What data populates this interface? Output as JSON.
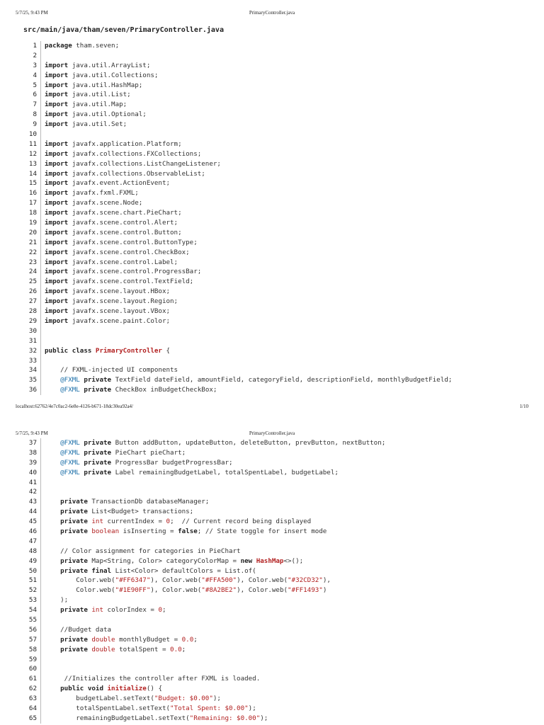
{
  "page1": {
    "header": {
      "datetime": "5/7/25, 9:43 PM",
      "title": "PrimaryController.java"
    },
    "file_path": "src/main/java/tham/seven/PrimaryController.java",
    "footer": {
      "url": "localhost:62762/4e7c0ac2-6e8e-4126-b671-18dc30ea92a4/",
      "page": "1/10"
    }
  },
  "page2": {
    "header": {
      "datetime": "5/7/25, 9:43 PM",
      "title": "PrimaryController.java"
    }
  },
  "lines_page1": [
    {
      "n": "1",
      "t": [
        [
          "kw",
          "package"
        ],
        [
          "id",
          " tham.seven;"
        ]
      ]
    },
    {
      "n": "2",
      "t": []
    },
    {
      "n": "3",
      "t": [
        [
          "kw",
          "import"
        ],
        [
          "id",
          " java.util.ArrayList;"
        ]
      ]
    },
    {
      "n": "4",
      "t": [
        [
          "kw",
          "import"
        ],
        [
          "id",
          " java.util.Collections;"
        ]
      ]
    },
    {
      "n": "5",
      "t": [
        [
          "kw",
          "import"
        ],
        [
          "id",
          " java.util.HashMap;"
        ]
      ]
    },
    {
      "n": "6",
      "t": [
        [
          "kw",
          "import"
        ],
        [
          "id",
          " java.util.List;"
        ]
      ]
    },
    {
      "n": "7",
      "t": [
        [
          "kw",
          "import"
        ],
        [
          "id",
          " java.util.Map;"
        ]
      ]
    },
    {
      "n": "8",
      "t": [
        [
          "kw",
          "import"
        ],
        [
          "id",
          " java.util.Optional;"
        ]
      ]
    },
    {
      "n": "9",
      "t": [
        [
          "kw",
          "import"
        ],
        [
          "id",
          " java.util.Set;"
        ]
      ]
    },
    {
      "n": "10",
      "t": []
    },
    {
      "n": "11",
      "t": [
        [
          "kw",
          "import"
        ],
        [
          "id",
          " javafx.application.Platform;"
        ]
      ]
    },
    {
      "n": "12",
      "t": [
        [
          "kw",
          "import"
        ],
        [
          "id",
          " javafx.collections.FXCollections;"
        ]
      ]
    },
    {
      "n": "13",
      "t": [
        [
          "kw",
          "import"
        ],
        [
          "id",
          " javafx.collections.ListChangeListener;"
        ]
      ]
    },
    {
      "n": "14",
      "t": [
        [
          "kw",
          "import"
        ],
        [
          "id",
          " javafx.collections.ObservableList;"
        ]
      ]
    },
    {
      "n": "15",
      "t": [
        [
          "kw",
          "import"
        ],
        [
          "id",
          " javafx.event.ActionEvent;"
        ]
      ]
    },
    {
      "n": "16",
      "t": [
        [
          "kw",
          "import"
        ],
        [
          "id",
          " javafx.fxml.FXML;"
        ]
      ]
    },
    {
      "n": "17",
      "t": [
        [
          "kw",
          "import"
        ],
        [
          "id",
          " javafx.scene.Node;"
        ]
      ]
    },
    {
      "n": "18",
      "t": [
        [
          "kw",
          "import"
        ],
        [
          "id",
          " javafx.scene.chart.PieChart;"
        ]
      ]
    },
    {
      "n": "19",
      "t": [
        [
          "kw",
          "import"
        ],
        [
          "id",
          " javafx.scene.control.Alert;"
        ]
      ]
    },
    {
      "n": "20",
      "t": [
        [
          "kw",
          "import"
        ],
        [
          "id",
          " javafx.scene.control.Button;"
        ]
      ]
    },
    {
      "n": "21",
      "t": [
        [
          "kw",
          "import"
        ],
        [
          "id",
          " javafx.scene.control.ButtonType;"
        ]
      ]
    },
    {
      "n": "22",
      "t": [
        [
          "kw",
          "import"
        ],
        [
          "id",
          " javafx.scene.control.CheckBox;"
        ]
      ]
    },
    {
      "n": "23",
      "t": [
        [
          "kw",
          "import"
        ],
        [
          "id",
          " javafx.scene.control.Label;"
        ]
      ]
    },
    {
      "n": "24",
      "t": [
        [
          "kw",
          "import"
        ],
        [
          "id",
          " javafx.scene.control.ProgressBar;"
        ]
      ]
    },
    {
      "n": "25",
      "t": [
        [
          "kw",
          "import"
        ],
        [
          "id",
          " javafx.scene.control.TextField;"
        ]
      ]
    },
    {
      "n": "26",
      "t": [
        [
          "kw",
          "import"
        ],
        [
          "id",
          " javafx.scene.layout.HBox;"
        ]
      ]
    },
    {
      "n": "27",
      "t": [
        [
          "kw",
          "import"
        ],
        [
          "id",
          " javafx.scene.layout.Region;"
        ]
      ]
    },
    {
      "n": "28",
      "t": [
        [
          "kw",
          "import"
        ],
        [
          "id",
          " javafx.scene.layout.VBox;"
        ]
      ]
    },
    {
      "n": "29",
      "t": [
        [
          "kw",
          "import"
        ],
        [
          "id",
          " javafx.scene.paint.Color;"
        ]
      ]
    },
    {
      "n": "30",
      "t": []
    },
    {
      "n": "31",
      "t": []
    },
    {
      "n": "32",
      "t": [
        [
          "kw",
          "public class "
        ],
        [
          "cls",
          "PrimaryController"
        ],
        [
          "id",
          " {"
        ]
      ]
    },
    {
      "n": "33",
      "t": []
    },
    {
      "n": "34",
      "t": [
        [
          "cmt",
          "    // FXML-injected UI components"
        ]
      ]
    },
    {
      "n": "35",
      "t": [
        [
          "ann",
          "    @FXML"
        ],
        [
          "kw",
          " private"
        ],
        [
          "id",
          " TextField dateField, amountField, categoryField, descriptionField, monthlyBudgetField;"
        ]
      ]
    },
    {
      "n": "36",
      "t": [
        [
          "ann",
          "    @FXML"
        ],
        [
          "kw",
          " private"
        ],
        [
          "id",
          " CheckBox inBudgetCheckBox;"
        ]
      ]
    }
  ],
  "lines_page2": [
    {
      "n": "37",
      "t": [
        [
          "ann",
          "    @FXML"
        ],
        [
          "kw",
          " private"
        ],
        [
          "id",
          " Button addButton, updateButton, deleteButton, prevButton, nextButton;"
        ]
      ]
    },
    {
      "n": "38",
      "t": [
        [
          "ann",
          "    @FXML"
        ],
        [
          "kw",
          " private"
        ],
        [
          "id",
          " PieChart pieChart;"
        ]
      ]
    },
    {
      "n": "39",
      "t": [
        [
          "ann",
          "    @FXML"
        ],
        [
          "kw",
          " private"
        ],
        [
          "id",
          " ProgressBar budgetProgressBar;"
        ]
      ]
    },
    {
      "n": "40",
      "t": [
        [
          "ann",
          "    @FXML"
        ],
        [
          "kw",
          " private"
        ],
        [
          "id",
          " Label remainingBudgetLabel, totalSpentLabel, budgetLabel;"
        ]
      ]
    },
    {
      "n": "41",
      "t": []
    },
    {
      "n": "42",
      "t": []
    },
    {
      "n": "43",
      "t": [
        [
          "kw",
          "    private"
        ],
        [
          "id",
          " TransactionDb databaseManager;"
        ]
      ]
    },
    {
      "n": "44",
      "t": [
        [
          "kw",
          "    private"
        ],
        [
          "id",
          " List<Budget> transactions;"
        ]
      ]
    },
    {
      "n": "45",
      "t": [
        [
          "kw",
          "    private"
        ],
        [
          "prim",
          " int"
        ],
        [
          "id",
          " currentIndex = "
        ],
        [
          "num",
          "0"
        ],
        [
          "id",
          ";  // Current record being displayed"
        ]
      ]
    },
    {
      "n": "46",
      "t": [
        [
          "kw",
          "    private"
        ],
        [
          "prim",
          " boolean"
        ],
        [
          "id",
          " isInserting = "
        ],
        [
          "kw",
          "false"
        ],
        [
          "id",
          "; // State toggle for insert mode"
        ]
      ]
    },
    {
      "n": "47",
      "t": []
    },
    {
      "n": "48",
      "t": [
        [
          "cmt",
          "    // Color assignment for categories in PieChart"
        ]
      ]
    },
    {
      "n": "49",
      "t": [
        [
          "kw",
          "    private"
        ],
        [
          "id",
          " Map<String, Color> categoryColorMap = "
        ],
        [
          "kw",
          "new"
        ],
        [
          "cls",
          " HashMap"
        ],
        [
          "id",
          "<>();"
        ]
      ]
    },
    {
      "n": "50",
      "t": [
        [
          "kw",
          "    private final"
        ],
        [
          "id",
          " List<Color> defaultColors = List.of("
        ]
      ]
    },
    {
      "n": "51",
      "t": [
        [
          "id",
          "        Color.web("
        ],
        [
          "str",
          "\"#FF6347\""
        ],
        [
          "id",
          "), Color.web("
        ],
        [
          "str",
          "\"#FFA500\""
        ],
        [
          "id",
          "), Color.web("
        ],
        [
          "str",
          "\"#32CD32\""
        ],
        [
          "id",
          "),"
        ]
      ]
    },
    {
      "n": "52",
      "t": [
        [
          "id",
          "        Color.web("
        ],
        [
          "str",
          "\"#1E90FF\""
        ],
        [
          "id",
          "), Color.web("
        ],
        [
          "str",
          "\"#8A2BE2\""
        ],
        [
          "id",
          "), Color.web("
        ],
        [
          "str",
          "\"#FF1493\""
        ],
        [
          "id",
          ")"
        ]
      ]
    },
    {
      "n": "53",
      "t": [
        [
          "id",
          "    );"
        ]
      ]
    },
    {
      "n": "54",
      "t": [
        [
          "kw",
          "    private"
        ],
        [
          "prim",
          " int"
        ],
        [
          "id",
          " colorIndex = "
        ],
        [
          "num",
          "0"
        ],
        [
          "id",
          ";"
        ]
      ]
    },
    {
      "n": "55",
      "t": []
    },
    {
      "n": "56",
      "t": [
        [
          "cmt",
          "    //Budget data"
        ]
      ]
    },
    {
      "n": "57",
      "t": [
        [
          "kw",
          "    private"
        ],
        [
          "prim",
          " double"
        ],
        [
          "id",
          " monthlyBudget = "
        ],
        [
          "num",
          "0.0"
        ],
        [
          "id",
          ";"
        ]
      ]
    },
    {
      "n": "58",
      "t": [
        [
          "kw",
          "    private"
        ],
        [
          "prim",
          " double"
        ],
        [
          "id",
          " totalSpent = "
        ],
        [
          "num",
          "0.0"
        ],
        [
          "id",
          ";"
        ]
      ]
    },
    {
      "n": "59",
      "t": []
    },
    {
      "n": "60",
      "t": []
    },
    {
      "n": "61",
      "t": [
        [
          "cmt",
          "     //Initializes the controller after FXML is loaded."
        ]
      ]
    },
    {
      "n": "62",
      "t": [
        [
          "kw",
          "    public void "
        ],
        [
          "cls",
          "initialize"
        ],
        [
          "id",
          "() {"
        ]
      ]
    },
    {
      "n": "63",
      "t": [
        [
          "id",
          "        budgetLabel.setText("
        ],
        [
          "str",
          "\"Budget: $0.00\""
        ],
        [
          "id",
          ");"
        ]
      ]
    },
    {
      "n": "64",
      "t": [
        [
          "id",
          "        totalSpentLabel.setText("
        ],
        [
          "str",
          "\"Total Spent: $0.00\""
        ],
        [
          "id",
          ");"
        ]
      ]
    },
    {
      "n": "65",
      "t": [
        [
          "id",
          "        remainingBudgetLabel.setText("
        ],
        [
          "str",
          "\"Remaining: $0.00\""
        ],
        [
          "id",
          ");"
        ]
      ]
    }
  ]
}
